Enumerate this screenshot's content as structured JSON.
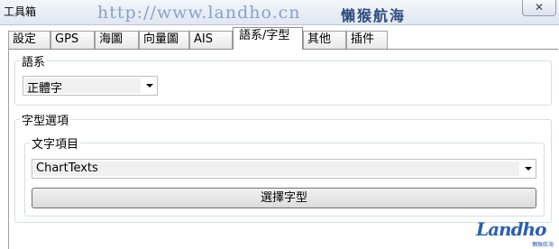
{
  "window": {
    "title": "工具箱",
    "close_label": "✕"
  },
  "watermark": {
    "url": "http://www.landho.cn",
    "name": "懶猴航海",
    "logo": "Landho",
    "logo_sub": "懶猴航海"
  },
  "tabs": [
    {
      "label": "設定",
      "active": false
    },
    {
      "label": "GPS",
      "active": false
    },
    {
      "label": "海圖",
      "active": false
    },
    {
      "label": "向量圖",
      "active": false
    },
    {
      "label": "AIS",
      "active": false
    },
    {
      "label": "語系/字型",
      "active": true
    },
    {
      "label": "其他",
      "active": false
    },
    {
      "label": "插件",
      "active": false
    }
  ],
  "language_group": {
    "label": "語系",
    "selected": "正體字"
  },
  "font_group": {
    "label": "字型選項",
    "text_items": {
      "label": "文字項目",
      "selected": "ChartTexts"
    },
    "choose_font_button": "選擇字型"
  },
  "colors": {
    "accent": "#2a5fb0",
    "tab_border": "#8e8f8f",
    "group_border": "#d5dfe5"
  }
}
